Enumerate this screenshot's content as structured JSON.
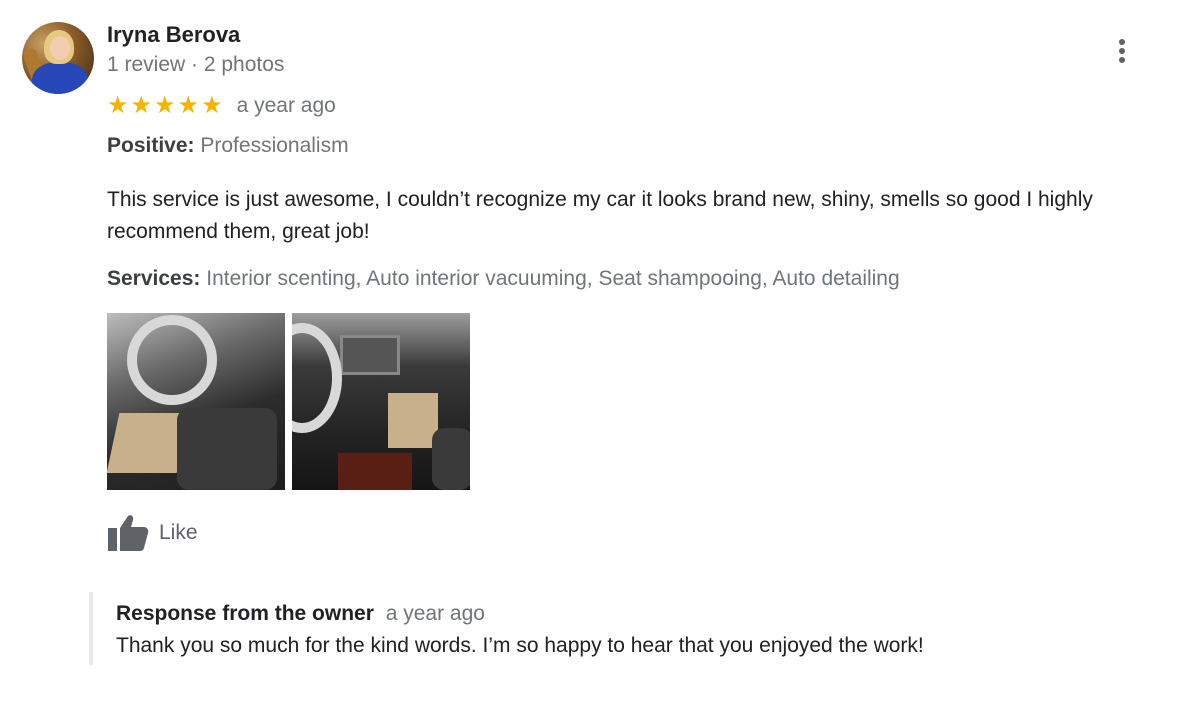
{
  "reviewer": {
    "name": "Iryna Berova",
    "meta": "1 review · 2 photos"
  },
  "review": {
    "rating": 5,
    "stars": [
      "★",
      "★",
      "★",
      "★",
      "★"
    ],
    "time": "a year ago",
    "positive_label": "Positive:",
    "positive_value": "Professionalism",
    "text": "This service is just awesome, I couldn’t recognize my car it looks brand new, shiny, smells so good I highly recommend them, great job!",
    "services_label": "Services:",
    "services_value": "Interior scenting, Auto interior vacuuming, Seat shampooing, Auto detailing",
    "like_label": "Like"
  },
  "owner_response": {
    "title": "Response from the owner",
    "time": "a year ago",
    "text": "Thank you so much for the kind words. I’m so happy to hear that you enjoyed the work!"
  },
  "icons": {
    "more": "more-vert-icon",
    "like": "thumbs-up-icon",
    "star": "star-icon"
  },
  "colors": {
    "star": "#f4b400",
    "text": "#202124",
    "secondary": "#70757a",
    "quote_bar": "#e8eaed"
  }
}
